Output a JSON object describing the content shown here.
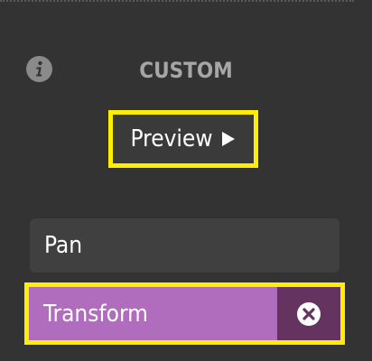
{
  "panel": {
    "title": "CUSTOM",
    "info_icon": "info-icon",
    "preview_button": {
      "label": "Preview",
      "icon": "play-icon"
    },
    "items": [
      {
        "label": "Pan",
        "selected": false
      },
      {
        "label": "Transform",
        "selected": true,
        "remove_icon": "close-circle-icon"
      }
    ]
  },
  "colors": {
    "background": "#333333",
    "highlight_border": "#ffee00",
    "item_background": "#404040",
    "selected_item": "#b06cbd",
    "remove_button": "#65335f",
    "title_text": "#a6a6a6"
  }
}
